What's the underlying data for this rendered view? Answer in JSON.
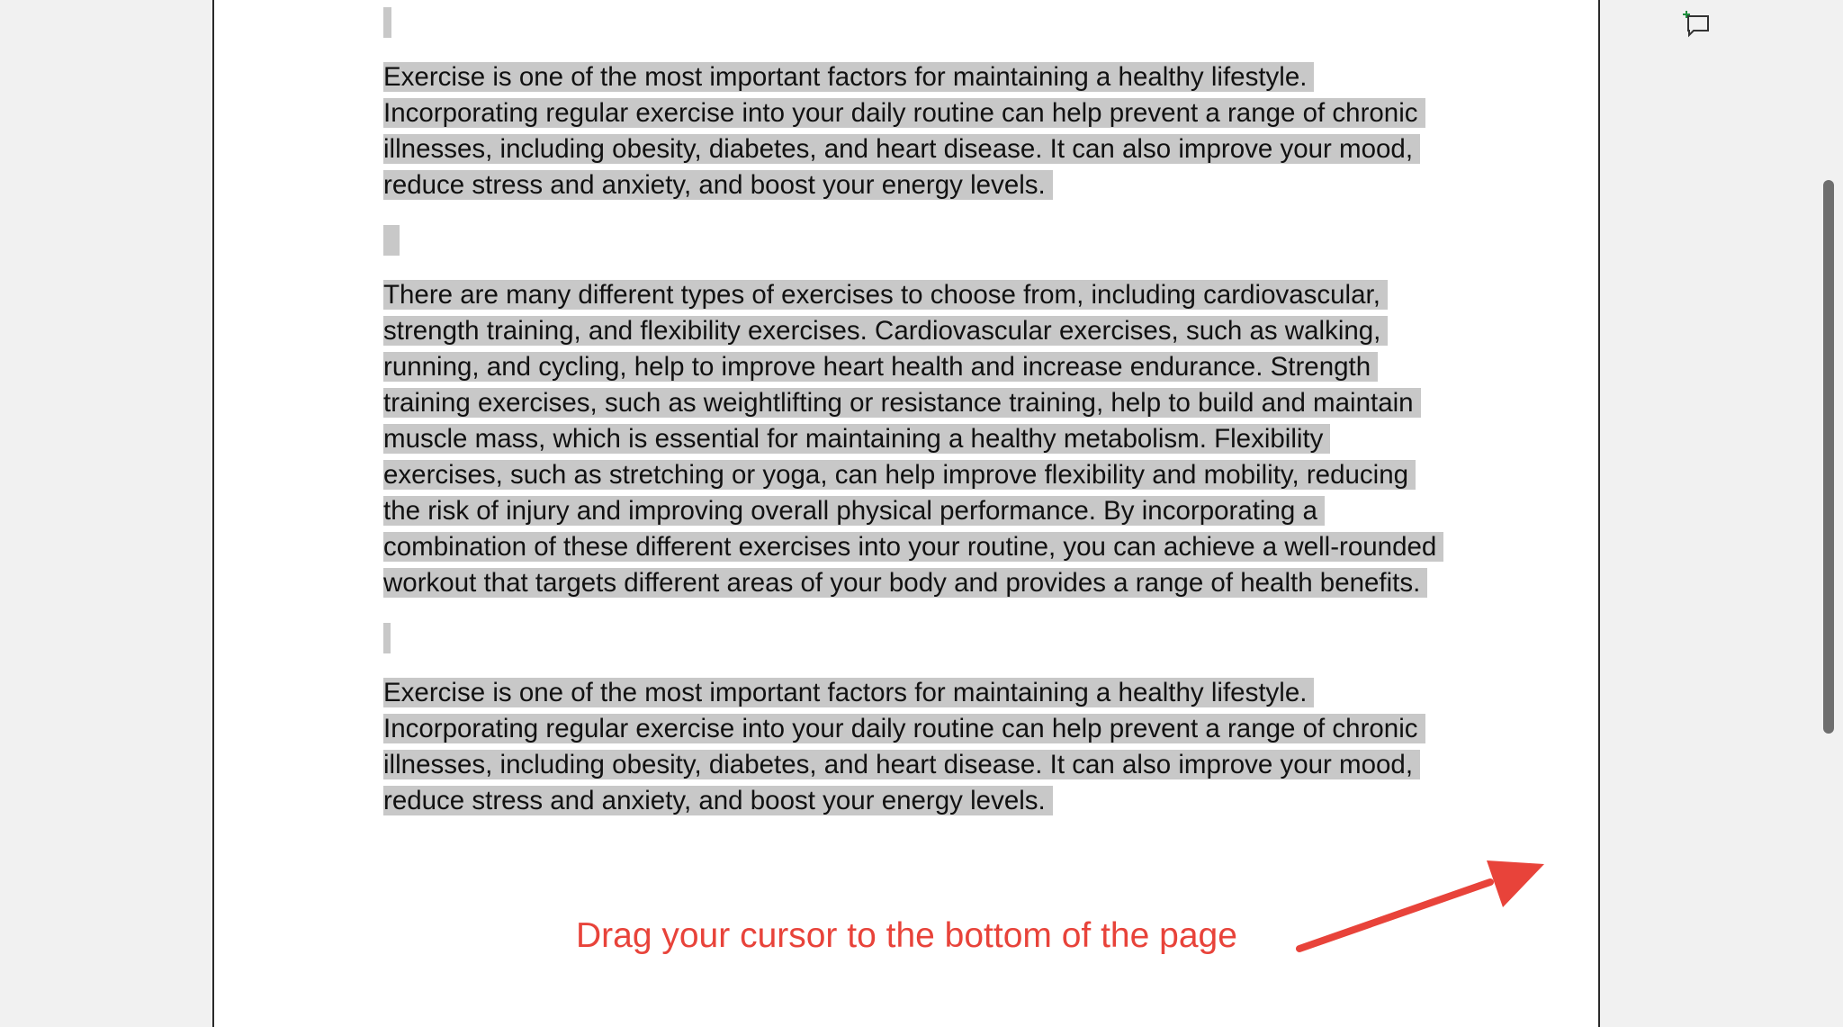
{
  "document": {
    "paragraphs": [
      "Exercise is one of the most important factors for maintaining a healthy lifestyle. Incorporating regular exercise into your daily routine can help prevent a range of chronic illnesses, including obesity, diabetes, and heart disease. It can also improve your mood, reduce stress and anxiety, and boost your energy levels.",
      "There are many different types of exercises to choose from, including cardiovascular, strength training, and flexibility exercises. Cardiovascular exercises, such as walking, running, and cycling, help to improve heart health and increase endurance. Strength training exercises, such as weightlifting or resistance training, help to build and maintain muscle mass, which is essential for maintaining a healthy metabolism. Flexibility exercises, such as stretching or yoga, can help improve flexibility and mobility, reducing the risk of injury and improving overall physical performance. By incorporating a combination of these different exercises into your routine, you can achieve a well-rounded workout that targets different areas of your body and provides a range of health benefits.",
      "Exercise is one of the most important factors for maintaining a healthy lifestyle. Incorporating regular exercise into your daily routine can help prevent a range of chronic illnesses, including obesity, diabetes, and heart disease. It can also improve your mood, reduce stress and anxiety, and boost your energy levels."
    ]
  },
  "annotation": {
    "text": "Drag your cursor to the bottom of the page",
    "color": "#e8433a"
  },
  "icons": {
    "add_comment": "add-comment-icon"
  },
  "colors": {
    "selection": "#c8c8c8",
    "page_background": "#ffffff",
    "app_background": "#f1f1f1"
  }
}
